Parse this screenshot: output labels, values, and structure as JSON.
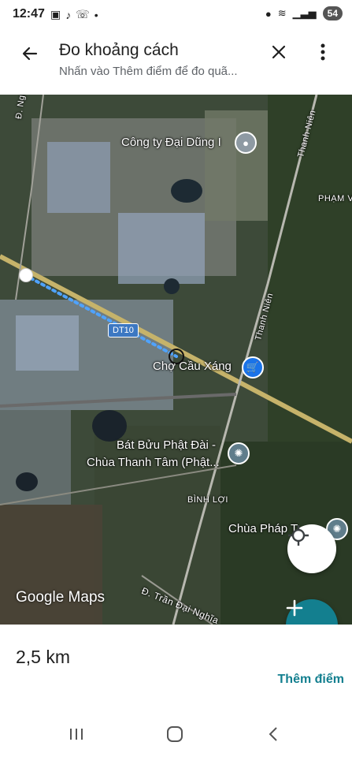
{
  "status_bar": {
    "time": "12:47",
    "battery": "54"
  },
  "header": {
    "title": "Đo khoảng cách",
    "subtitle": "Nhấn vào Thêm điểm để đo quã..."
  },
  "map": {
    "labels": {
      "company": "Công ty Đại Dũng I",
      "street_nguyen": "Đ. Nguyễn",
      "street_thanh_nien_top": "Thanh Niên",
      "street_thanh_nien_mid": "Thanh Niên",
      "pham_v": "PHẠM V",
      "route": "DT10",
      "market": "Chợ Cầu Xáng",
      "pagoda1_line1": "Bát Bửu Phật Đài -",
      "pagoda1_line2": "Chùa Thanh Tâm (Phật...",
      "binh_loi": "BÌNH LỢI",
      "pagoda2": "Chùa Pháp T",
      "street_tran_dai_nghia": "Đ. Trần Đại Nghĩa"
    },
    "attribution": "Google Maps"
  },
  "bottom_panel": {
    "distance": "2,5 km",
    "add_point_label": "Thêm điểm"
  }
}
